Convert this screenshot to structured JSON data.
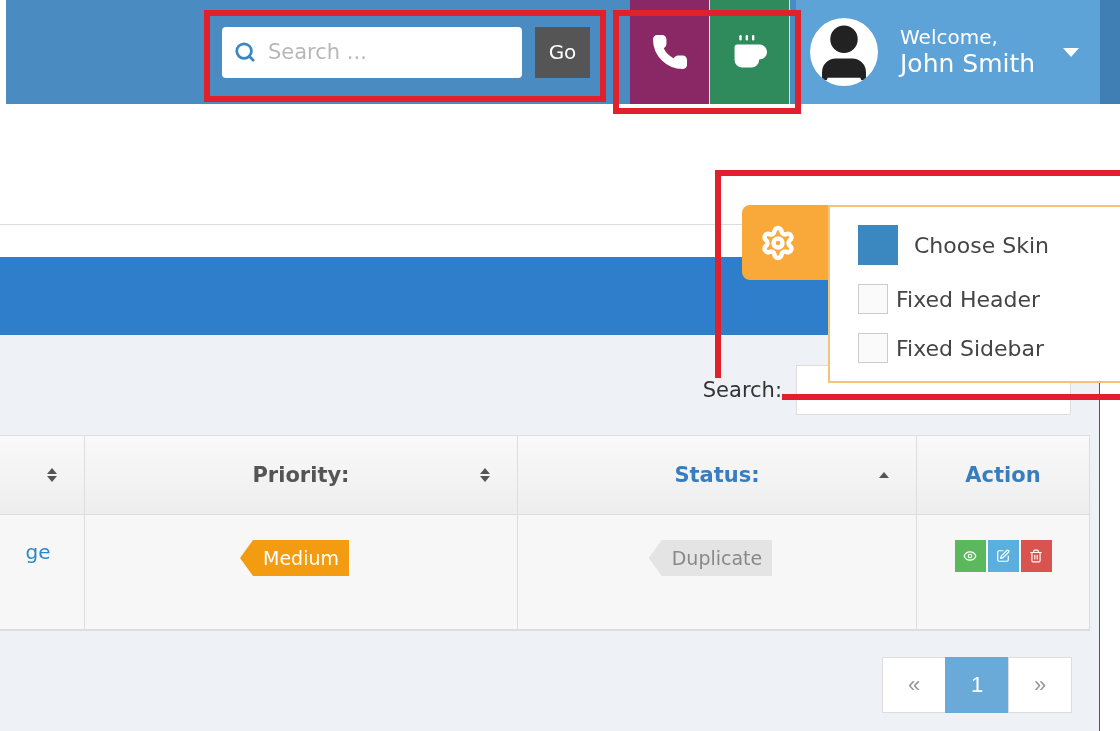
{
  "header": {
    "search": {
      "placeholder": "Search ...",
      "button": "Go"
    },
    "quick_buttons": [
      {
        "kind": "phone",
        "color": "#8a2866"
      },
      {
        "kind": "coffee",
        "color": "#2f8a5c"
      }
    ],
    "user": {
      "greeting": "Welcome,",
      "name": "John Smith"
    }
  },
  "settings": {
    "items": [
      {
        "kind": "skin",
        "label": "Choose Skin",
        "color": "#3b87bf"
      },
      {
        "kind": "checkbox",
        "label": "Fixed Header",
        "checked": false
      },
      {
        "kind": "checkbox",
        "label": "Fixed Sidebar",
        "checked": false
      }
    ]
  },
  "table_search": {
    "label": "Search:"
  },
  "table": {
    "columns": [
      {
        "sortable": true,
        "sorted": false
      },
      {
        "label": "Priority:",
        "sortable": true,
        "sorted": false
      },
      {
        "label": "Status:",
        "sortable": true,
        "sorted": true
      },
      {
        "label": "Action",
        "sortable": false,
        "sorted": false
      }
    ],
    "rows": [
      {
        "column_1": "ge",
        "priority": {
          "text": "Medium",
          "color": "#f39c12"
        },
        "status": {
          "text": "Duplicate",
          "color": "#e4e4e4"
        },
        "actions": [
          {
            "kind": "view"
          },
          {
            "kind": "edit"
          },
          {
            "kind": "delete"
          }
        ]
      }
    ]
  },
  "pagination": [
    {
      "label": "«",
      "selected": false
    },
    {
      "label": "1",
      "selected": true
    },
    {
      "label": "»",
      "selected": false
    }
  ]
}
